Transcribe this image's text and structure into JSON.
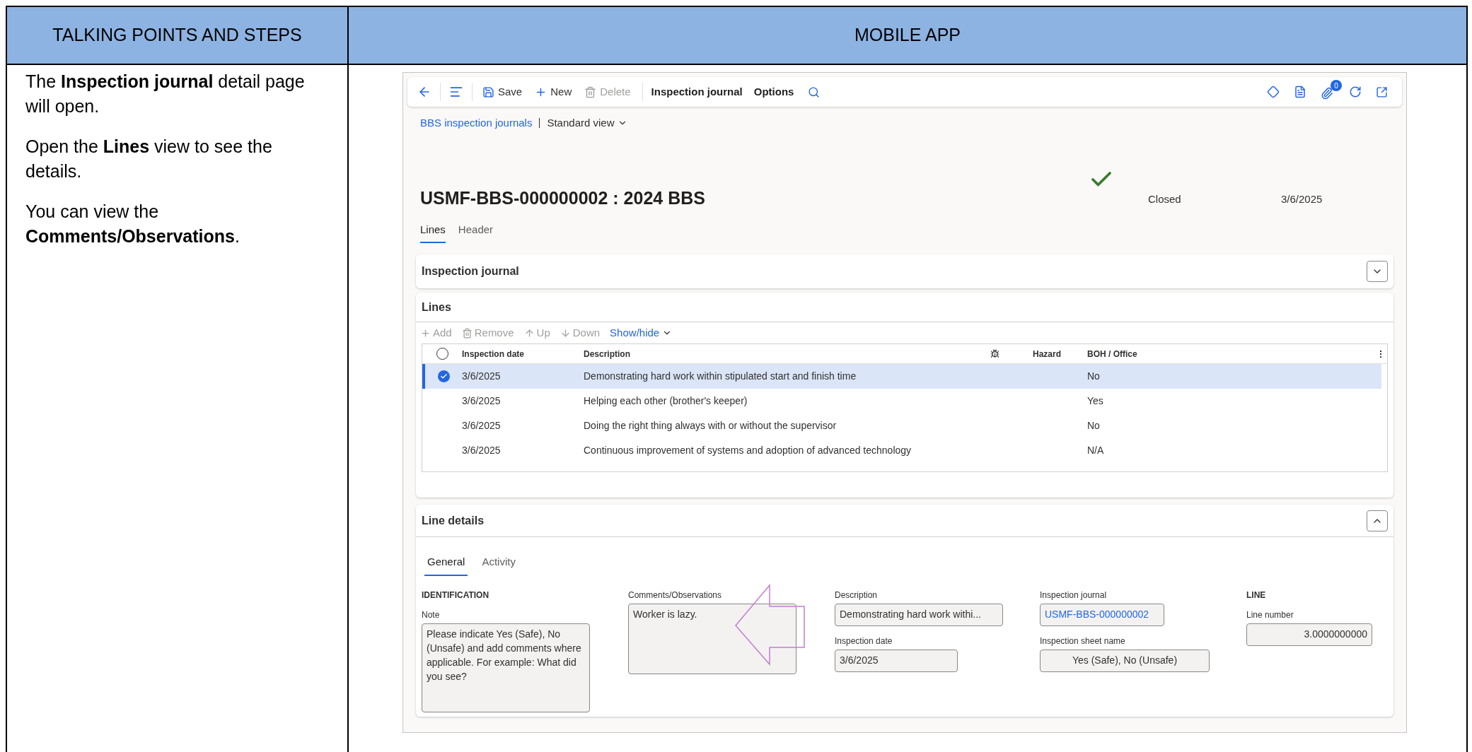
{
  "table_headers": [
    "TALKING POINTS AND STEPS",
    "MOBILE APP"
  ],
  "steps": [
    "The **Inspection journal** detail page will open.",
    "Open the **Lines** view to see the details.",
    "You can view the **Comments/Observations**."
  ],
  "app": {
    "toolbar": {
      "buttons": [
        {
          "kind": "save",
          "label": "Save",
          "disabled": false
        },
        {
          "kind": "new",
          "label": "New",
          "disabled": false
        },
        {
          "kind": "delete",
          "label": "Delete",
          "disabled": true
        }
      ],
      "menus": [
        "Inspection journal",
        "Options"
      ],
      "notification_count": "0"
    },
    "breadcrumb": {
      "link": "BBS inspection journals",
      "view": "Standard view"
    },
    "title": "USMF-BBS-000000002 : 2024 BBS",
    "status": "Closed",
    "status_date": "3/6/2025",
    "tabs": [
      {
        "label": "Lines",
        "selected": true
      },
      {
        "label": "Header",
        "selected": false
      }
    ],
    "journal_section": {
      "title": "Inspection journal",
      "expanded": false
    },
    "lines": {
      "title": "Lines",
      "actions": [
        {
          "kind": "add",
          "label": "Add",
          "disabled": true
        },
        {
          "kind": "remove",
          "label": "Remove",
          "disabled": true
        },
        {
          "kind": "up",
          "label": "Up",
          "disabled": true
        },
        {
          "kind": "down",
          "label": "Down",
          "disabled": true
        }
      ],
      "show_hide": "Show/hide",
      "all_selected": false,
      "columns": [
        {
          "kind": "text",
          "label": "Inspection date"
        },
        {
          "kind": "text",
          "label": "Description"
        },
        {
          "kind": "icon"
        },
        {
          "kind": "text",
          "label": "Hazard"
        },
        {
          "kind": "text",
          "label": "BOH / Office"
        }
      ],
      "rows": [
        {
          "selected": true,
          "date": "3/6/2025",
          "description": "Demonstrating hard work within stipulated start and finish time",
          "boh": "No"
        },
        {
          "selected": false,
          "date": "3/6/2025",
          "description": "Helping each other (brother's keeper)",
          "boh": "Yes"
        },
        {
          "selected": false,
          "date": "3/6/2025",
          "description": "Doing the right thing always with or without the supervisor",
          "boh": "No"
        },
        {
          "selected": false,
          "date": "3/6/2025",
          "description": "Continuous improvement of systems and adoption of advanced technology",
          "boh": "N/A"
        }
      ]
    },
    "line_details": {
      "title": "Line details",
      "expanded": true,
      "tabs": [
        {
          "label": "General",
          "selected": true
        },
        {
          "label": "Activity",
          "selected": false
        }
      ],
      "identification_heading": "IDENTIFICATION",
      "note_label": "Note",
      "note": "Please indicate Yes (Safe), No (Unsafe) and add comments where applicable. For example: What did you see?",
      "comments_label": "Comments/Observations",
      "comments": "Worker is lazy.",
      "description_label": "Description",
      "description": "Demonstrating hard work withi...",
      "inspection_date_label": "Inspection date",
      "inspection_date": "3/6/2025",
      "journal_label": "Inspection journal",
      "journal": "USMF-BBS-000000002",
      "sheet_label": "Inspection sheet name",
      "sheet": "Yes (Safe), No (Unsafe)",
      "line_heading": "LINE",
      "line_number_label": "Line number",
      "line_number": "3.0000000000"
    }
  }
}
